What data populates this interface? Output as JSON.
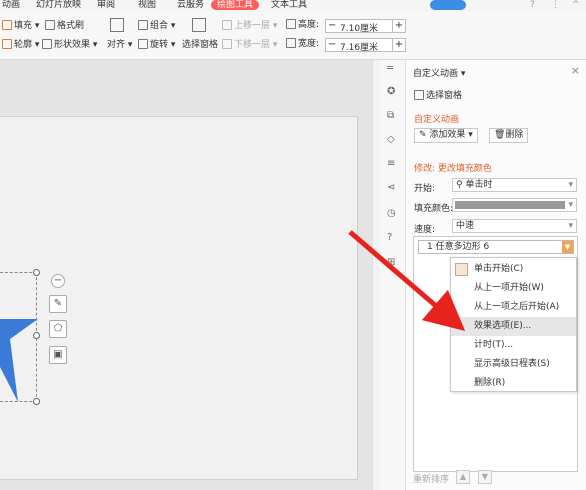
{
  "menubar": {
    "items": [
      "动画",
      "幻灯片放映",
      "审阅",
      "视图",
      "云服务",
      "绘图工具",
      "文本工具"
    ],
    "active_index": 5,
    "right_icons": [
      "search-icon",
      "help-icon",
      "more-icon"
    ],
    "active_color": "#ff5b5b"
  },
  "ribbon": {
    "fill": "填充",
    "format_brush": "格式刷",
    "outline": "轮廓",
    "shape_effect": "形状效果",
    "align": "对齐",
    "group": "组合",
    "rotate": "旋转",
    "select_pane": "选择窗格",
    "bring_up": "上移一层",
    "send_down": "下移一层",
    "height_label": "高度:",
    "height_value": "7.10厘米",
    "width_label": "宽度:",
    "width_value": "7.16厘米",
    "minus": "−",
    "plus": "+"
  },
  "panel": {
    "title": "自定义动画",
    "title_arrow": "▾",
    "close": "×",
    "select_pane": "选择窗格",
    "section_title": "自定义动画",
    "add_effect": "添加效果",
    "delete": "删除",
    "modify": "修改: 更改填充颜色",
    "start_label": "开始:",
    "start_value": "单击时",
    "fill_label": "填充颜色:",
    "speed_label": "速度:",
    "speed_value": "中速",
    "list_item": "1  任意多边形 6",
    "reorder": "重新排序",
    "fill_swatch": "#9a9a9a",
    "accent": "#e0602b"
  },
  "context_menu": {
    "items": [
      "单击开始(C)",
      "从上一项开始(W)",
      "从上一项之后开始(A)",
      "效果选项(E)...",
      "计时(T)...",
      "显示高级日程表(S)",
      "删除(R)"
    ],
    "highlighted_index": 3
  },
  "canvas": {
    "shape_color": "#3a7bd5",
    "arrow_color": "#e8231e",
    "mini_toolbar": [
      "minus-circle-icon",
      "pen-icon",
      "eraser-icon",
      "frame-icon"
    ]
  }
}
